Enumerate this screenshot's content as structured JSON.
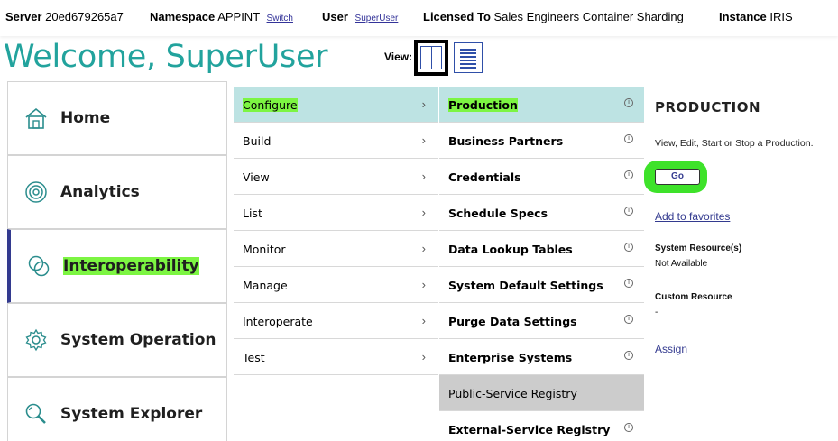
{
  "topbar": {
    "server_label": "Server",
    "server_value": "20ed679265a7",
    "namespace_label": "Namespace",
    "namespace_value": "APPINT",
    "switch_link": "Switch",
    "user_label": "User",
    "user_value": "SuperUser",
    "licensed_label": "Licensed To",
    "licensed_value": "Sales Engineers Container Sharding",
    "instance_label": "Instance",
    "instance_value": "IRIS"
  },
  "header": {
    "welcome": "Welcome, SuperUser",
    "view_label": "View:"
  },
  "nav": {
    "items": [
      {
        "label": "Home",
        "icon": "home-icon"
      },
      {
        "label": "Analytics",
        "icon": "target-icon"
      },
      {
        "label": "Interoperability",
        "icon": "rings-icon",
        "active": true
      },
      {
        "label": "System Operation",
        "icon": "gear-icon"
      },
      {
        "label": "System Explorer",
        "icon": "search-icon"
      }
    ]
  },
  "menu1": {
    "items": [
      "Configure",
      "Build",
      "View",
      "List",
      "Monitor",
      "Manage",
      "Interoperate",
      "Test"
    ],
    "selected": "Configure"
  },
  "menu2": {
    "items": [
      "Production",
      "Business Partners",
      "Credentials",
      "Schedule Specs",
      "Data Lookup Tables",
      "System Default Settings",
      "Purge Data Settings",
      "Enterprise Systems",
      "Public-Service Registry",
      "External-Service Registry"
    ],
    "selected": "Production",
    "info_glyph": "i"
  },
  "detail": {
    "heading": "PRODUCTION",
    "description": "View, Edit, Start or Stop a Production.",
    "go_label": "Go",
    "favorites_link": "Add to favorites",
    "system_resources_label": "System Resource(s)",
    "system_resources_value": "Not Available",
    "custom_resource_label": "Custom Resource",
    "custom_resource_value": "-",
    "assign_link": "Assign"
  },
  "colors": {
    "accent_teal": "#22a39d",
    "selection": "#bde3e3",
    "highlight": "#7cf542",
    "active_bar": "#333a8f",
    "link": "#333a8f"
  }
}
